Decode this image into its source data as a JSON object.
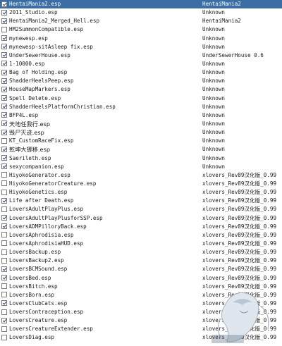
{
  "plugins": [
    {
      "name": "HentaiMania2.esp",
      "author": "HentaiMania2",
      "checked": true,
      "selected": true
    },
    {
      "name": "2011_Studio.esp",
      "author": "Unknown",
      "checked": true,
      "selected": false
    },
    {
      "name": "HentaiMania2_Merged_Hell.esp",
      "author": "HentaiMania2",
      "checked": true,
      "selected": false
    },
    {
      "name": "HM2SummonCompatible.esp",
      "author": "Unknown",
      "checked": false,
      "selected": false
    },
    {
      "name": "mynewesp.esp",
      "author": "Unknown",
      "checked": true,
      "selected": false
    },
    {
      "name": "mynewesp-sitAsleep fix.esp",
      "author": "Unknown",
      "checked": true,
      "selected": false
    },
    {
      "name": "UnderSewerHouse.esp",
      "author": "UnderSewerHouse 0.6",
      "checked": true,
      "selected": false
    },
    {
      "name": "1-10000.esp",
      "author": "Unknown",
      "checked": true,
      "selected": false
    },
    {
      "name": "Bag of Holding.esp",
      "author": "Unknown",
      "checked": true,
      "selected": false
    },
    {
      "name": "ShadderHeelsPeep.esp",
      "author": "Unknown",
      "checked": true,
      "selected": false
    },
    {
      "name": "HouseMapMarkers.esp",
      "author": "Unknown",
      "checked": true,
      "selected": false
    },
    {
      "name": "Spell Delete.esp",
      "author": "Unknown",
      "checked": true,
      "selected": false
    },
    {
      "name": "ShadderHeelsPlatformChristian.esp",
      "author": "Unknown",
      "checked": true,
      "selected": false
    },
    {
      "name": "BFP4L.esp",
      "author": "Unknown",
      "checked": true,
      "selected": false
    },
    {
      "name": "天地任我行.esp",
      "author": "Unknown",
      "checked": true,
      "selected": false
    },
    {
      "name": "毁尸灭迹.esp",
      "author": "Unknown",
      "checked": true,
      "selected": false
    },
    {
      "name": "KT_CustomRaceFix.esp",
      "author": "Unknown",
      "checked": false,
      "selected": false
    },
    {
      "name": "乾坤大挪移.esp",
      "author": "Unknown",
      "checked": true,
      "selected": false
    },
    {
      "name": "Saerileth.esp",
      "author": "Unknown",
      "checked": true,
      "selected": false
    },
    {
      "name": "sexycompanion.esp",
      "author": "Unknown",
      "checked": true,
      "selected": false
    },
    {
      "name": "HiyokoGenerator.esp",
      "author": "xlovers_Rev89汉化版_0.99",
      "checked": false,
      "selected": false
    },
    {
      "name": "HiyokoGeneratorCreature.esp",
      "author": "xlovers_Rev89汉化版_0.99",
      "checked": false,
      "selected": false
    },
    {
      "name": "HiyokoGenetics.esp",
      "author": "xlovers_Rev89汉化版_0.99",
      "checked": false,
      "selected": false
    },
    {
      "name": "Life after Death.esp",
      "author": "xlovers_Rev89汉化版_0.99",
      "checked": true,
      "selected": false
    },
    {
      "name": "LoversAdultPlayPlus.esp",
      "author": "xlovers_Rev89汉化版_0.99",
      "checked": false,
      "selected": false
    },
    {
      "name": "LoversAdultPlayPlusforSSP.esp",
      "author": "xlovers_Rev89汉化版_0.99",
      "checked": true,
      "selected": false
    },
    {
      "name": "LoversADMPilloryBack.esp",
      "author": "xlovers_Rev89汉化版_0.99",
      "checked": true,
      "selected": false
    },
    {
      "name": "LoversAphrodisia.esp",
      "author": "xlovers_Rev89汉化版_0.99",
      "checked": false,
      "selected": false
    },
    {
      "name": "LoversAphrodisiaHUD.esp",
      "author": "xlovers_Rev89汉化版_0.99",
      "checked": false,
      "selected": false
    },
    {
      "name": "LoversBackup.esp",
      "author": "xlovers_Rev89汉化版_0.99",
      "checked": false,
      "selected": false
    },
    {
      "name": "LoversBackup2.esp",
      "author": "xlovers_Rev89汉化版_0.99",
      "checked": false,
      "selected": false
    },
    {
      "name": "LoversBCMSound.esp",
      "author": "xlovers_Rev89汉化版_0.99",
      "checked": true,
      "selected": false
    },
    {
      "name": "LoversBed.esp",
      "author": "xlovers_Rev89汉化版_0.99",
      "checked": true,
      "selected": false
    },
    {
      "name": "LoversBitch.esp",
      "author": "xlovers_Rev89汉化版_0.99",
      "checked": false,
      "selected": false
    },
    {
      "name": "LoversBorn.esp",
      "author": "xlovers_Rev89汉化版_0.99",
      "checked": false,
      "selected": false
    },
    {
      "name": "LoversClubCats.esp",
      "author": "xlovers_Rev89汉化版_0.99",
      "checked": true,
      "selected": false
    },
    {
      "name": "LoversContraception.esp",
      "author": "xlovers_Rev89汉化版_0.99",
      "checked": false,
      "selected": false
    },
    {
      "name": "LoversCreature.esp",
      "author": "xlovers_Rev89汉化版_0.99",
      "checked": true,
      "selected": false
    },
    {
      "name": "LoversCreatureExtender.esp",
      "author": "xlovers_Rev89汉化版_0.99",
      "checked": false,
      "selected": false
    },
    {
      "name": "LoversDiag.esp",
      "author": "xlovers_Rev89汉化版_0.99",
      "checked": false,
      "selected": false
    }
  ],
  "watermark": {
    "text": ""
  }
}
